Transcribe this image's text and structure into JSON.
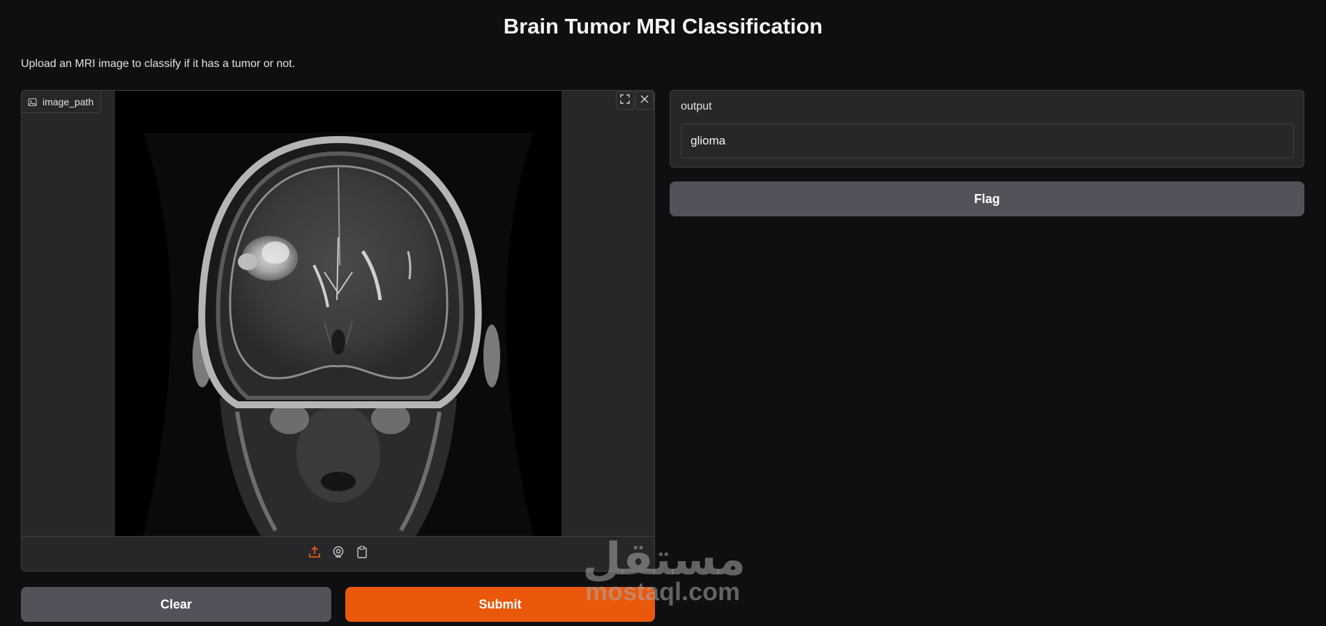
{
  "header": {
    "title": "Brain Tumor MRI Classification",
    "description": "Upload an MRI image to classify if it has a tumor or not."
  },
  "image_input": {
    "label": "image_path",
    "icons": [
      "image-icon",
      "fullscreen-icon",
      "close-icon",
      "upload-icon",
      "webcam-icon",
      "clipboard-icon"
    ],
    "accent_color": "#ea580c"
  },
  "output": {
    "label": "output",
    "value": "glioma"
  },
  "buttons": {
    "clear": "Clear",
    "submit": "Submit",
    "flag": "Flag"
  },
  "watermark": {
    "arabic": "مستقل",
    "latin": "mostaql.com"
  },
  "colors": {
    "background": "#0f0f11",
    "panel": "#27272a",
    "secondary_button": "#52525b",
    "primary_button": "#ea580c"
  }
}
